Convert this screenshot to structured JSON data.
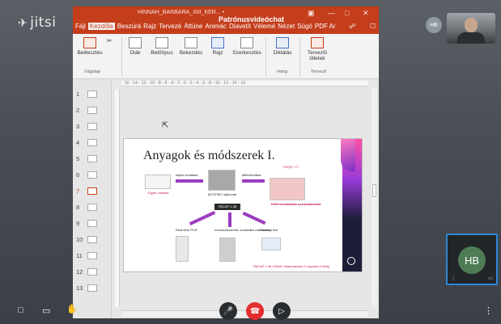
{
  "jitsi": {
    "logo": "jitsi",
    "avatar_small": "HB",
    "tile_initials": "HB"
  },
  "ppt": {
    "window_title": "HINNAH_BARBARA_XIII_KER... •",
    "screen_share_label": "Patrónusvideóchat",
    "menu": [
      "Fájl",
      "Kezdőla",
      "Beszúrá",
      "Rajz",
      "Tervezé",
      "Áttúne",
      "Animác",
      "Diavetít",
      "Vélemé",
      "Nézet",
      "Súgó",
      "PDF Ar"
    ],
    "active_menu_index": 1,
    "ribbon": {
      "paste": "Beillesztés",
      "slides": "Diák",
      "font": "Betűtípus",
      "paragraph": "Bekezdés",
      "draw": "Rajz",
      "edit": "Szerkesztés",
      "dictate": "Diktálás",
      "designer": "Tervezői ötletek",
      "group_clipboard": "Vágólap",
      "group_voice": "Hang",
      "group_designer": "Tervező"
    },
    "ruler": "·16···14···12···10···8···6···4···2···0···2···4···6···8···10···12···14···16·",
    "slide_numbers": [
      "1",
      "2",
      "3",
      "4",
      "5",
      "6",
      "7",
      "8",
      "9",
      "10",
      "11",
      "12",
      "13"
    ],
    "active_slide_index": 6
  },
  "slide": {
    "title": "Anyagok és módszerek I.",
    "label_rat": "Egyér calvaria",
    "label_isolate": "sejtek izolálása",
    "label_mc3t3": "MC3T3E1 sejtvonal",
    "label_diff": "differenciálás",
    "label_tgf": "TGFβ1 ???",
    "label_osteo": "Differenciálódott oszteoblasztok",
    "label_hub": "PACAP 1-38",
    "label_rtpcr": "Real-time PCR",
    "label_microscope": "Immuncitokémia, konfokális mikroszkóp",
    "label_wb": "Western blot",
    "footer": "PACAP 1-38 100nM, folyamatosan 2 naponta 2 hétig"
  },
  "toolbar": {
    "chat_icon": "chat-icon",
    "screen_icon": "screen-share-icon",
    "hand_icon": "raise-hand-icon",
    "mic_icon": "mic-muted-icon",
    "hangup_icon": "hangup-icon",
    "camera_icon": "camera-icon",
    "more_icon": "more-icon"
  }
}
